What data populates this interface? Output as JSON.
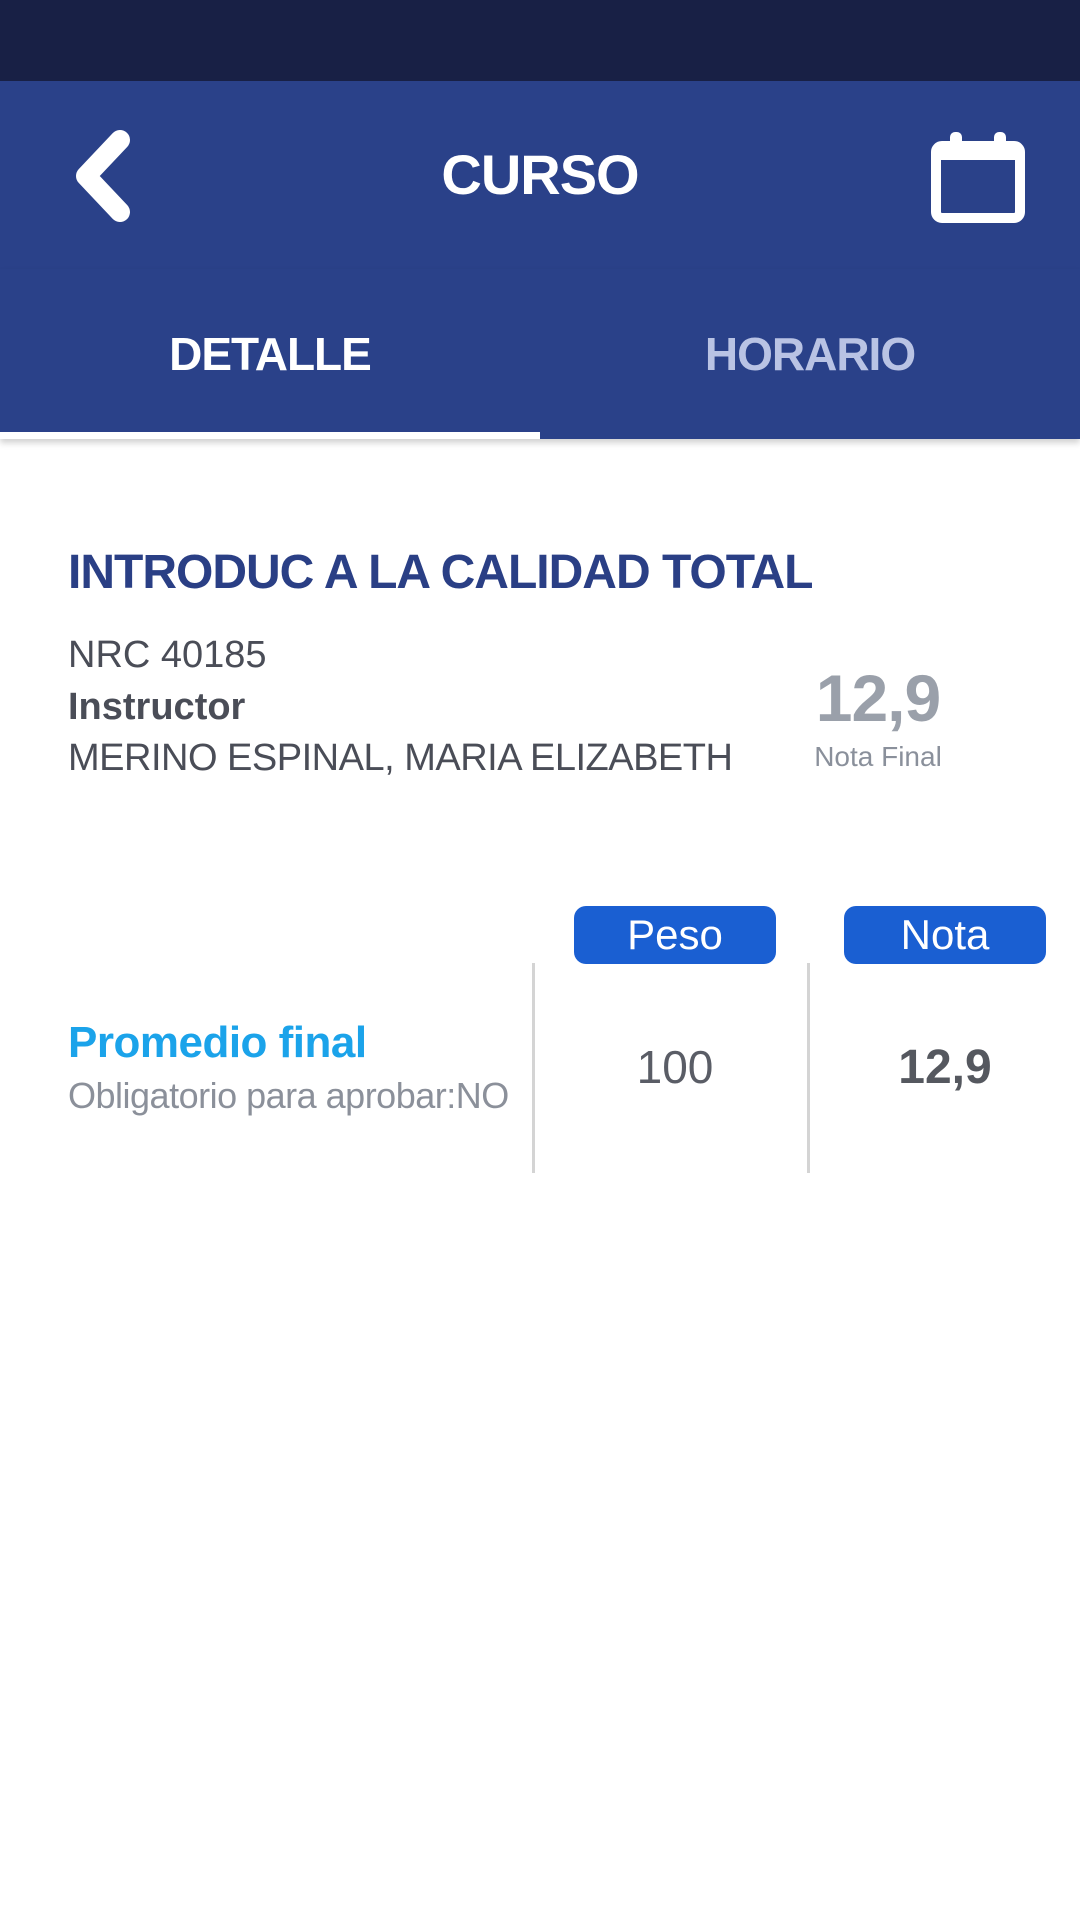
{
  "header": {
    "title": "CURSO",
    "back_icon": "chevron-left-icon",
    "calendar_icon": "calendar-icon"
  },
  "tabs": [
    {
      "label": "DETALLE",
      "active": true
    },
    {
      "label": "HORARIO",
      "active": false
    }
  ],
  "course": {
    "title": "INTRODUC A LA CALIDAD TOTAL",
    "nrc": "NRC 40185",
    "instructor_label": "Instructor",
    "instructor_name": "MERINO ESPINAL, MARIA ELIZABETH",
    "final_grade": "12,9",
    "final_grade_label": "Nota Final"
  },
  "grades_table": {
    "headers": {
      "peso": "Peso",
      "nota": "Nota"
    },
    "rows": [
      {
        "title": "Promedio final",
        "subtitle": "Obligatorio para aprobar:NO",
        "peso": "100",
        "nota": "12,9"
      }
    ]
  },
  "colors": {
    "status_bar": "#182045",
    "primary": "#2a4189",
    "accent_blue": "#1a5fd2",
    "link_blue": "#1ba3ea",
    "inactive_tab": "#b9c3e4"
  }
}
